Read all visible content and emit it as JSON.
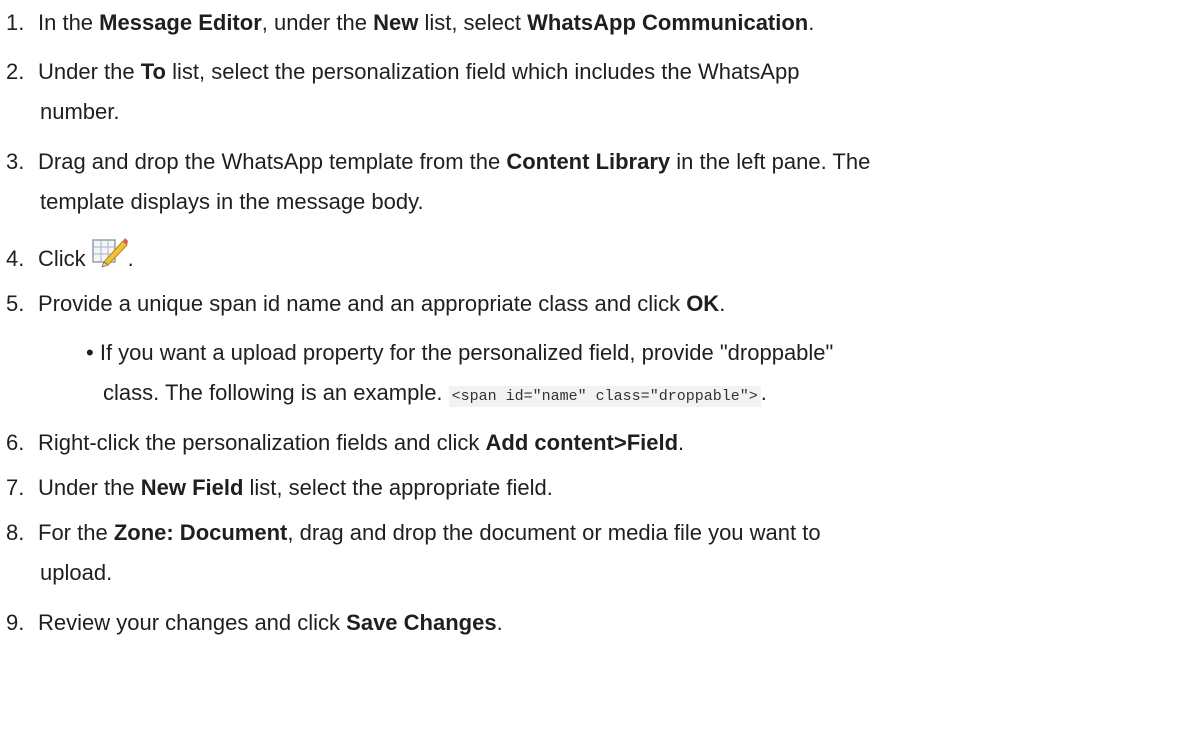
{
  "steps": [
    {
      "n": "1.",
      "a": "In the ",
      "b1": "Message Editor",
      "c": ", under the ",
      "b2": "New",
      "d": " list, select ",
      "b3": "WhatsApp Communication",
      "e": "."
    },
    {
      "n": "2.",
      "a": "Under the ",
      "b1": "To",
      "c": " list, select the personalization field which includes the WhatsApp",
      "d": "number."
    },
    {
      "n": "3.",
      "a": "Drag and drop the WhatsApp template from the ",
      "b1": "Content Library",
      "c": " in the left pane. The",
      "d": "template displays in the message body."
    },
    {
      "n": "4.",
      "a": "Click",
      "e": "."
    },
    {
      "n": "5.",
      "a": "Provide a unique span id name and an appropriate class and click ",
      "b1": "OK",
      "e": "."
    },
    {
      "n": "6.",
      "a": "Right-click the personalization fields and click ",
      "b1": "Add content>Field",
      "e": "."
    },
    {
      "n": "7.",
      "a": "Under the ",
      "b1": "New Field",
      "c": " list, select the appropriate field."
    },
    {
      "n": "8.",
      "a": "For the ",
      "b1": "Zone: Document",
      "c": ", drag and drop the document or media file you want to",
      "d": "upload."
    },
    {
      "n": "9.",
      "a": "Review your changes and click ",
      "b1": "Save Changes",
      "e": "."
    }
  ],
  "bullet": {
    "mark": "•",
    "line1": "If you want a upload property for the personalized field, provide \"droppable\"",
    "line2": "class. The following is an example. ",
    "code": "<span id=\"name\" class=\"droppable\">",
    "end": "."
  },
  "icons": {
    "edit": "edit-field-icon"
  }
}
